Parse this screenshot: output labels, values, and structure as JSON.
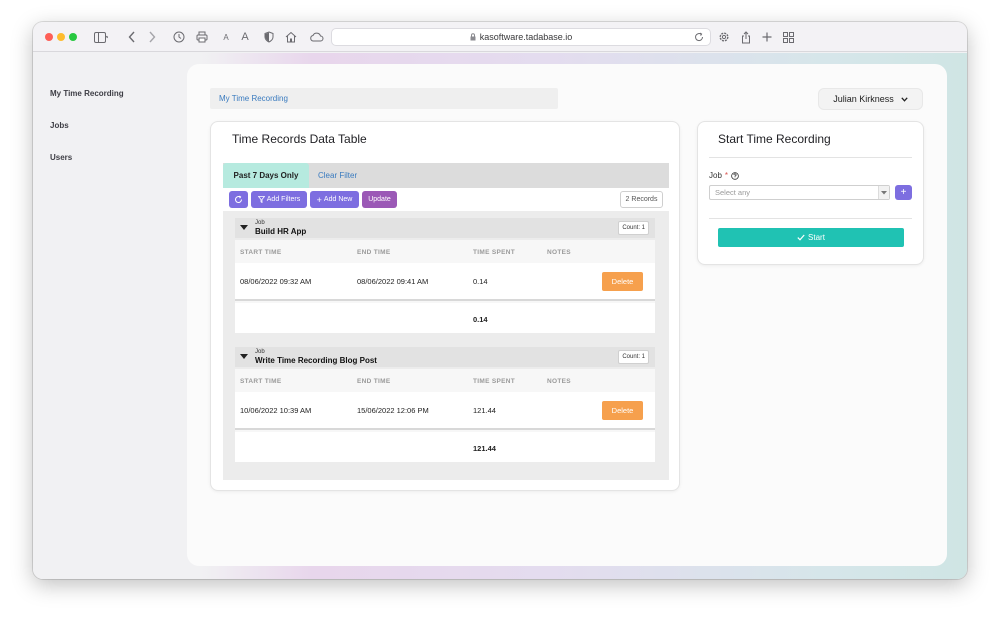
{
  "browser": {
    "url": "kasoftware.tadabase.io"
  },
  "sidebar": {
    "items": [
      {
        "label": "My Time Recording"
      },
      {
        "label": "Jobs"
      },
      {
        "label": "Users"
      }
    ]
  },
  "header": {
    "breadcrumb": "My Time Recording",
    "user_name": "Julian Kirkness"
  },
  "table_card": {
    "title": "Time Records Data Table",
    "tabs": {
      "active": "Past 7 Days Only",
      "link": "Clear Filter"
    },
    "toolbar": {
      "add_filters": "Add Filters",
      "add_new": "Add New",
      "update": "Update",
      "records": "2 Records"
    },
    "columns": [
      "START TIME",
      "END TIME",
      "TIME SPENT",
      "NOTES"
    ],
    "group_label": "Job",
    "groups": [
      {
        "name": "Build HR App",
        "count": "Count: 1",
        "row": {
          "start": "08/06/2022 09:32 AM",
          "end": "08/06/2022 09:41 AM",
          "spent": "0.14",
          "action": "Delete"
        },
        "total": "0.14"
      },
      {
        "name": "Write Time Recording Blog Post",
        "count": "Count: 1",
        "row": {
          "start": "10/06/2022 10:39 AM",
          "end": "15/06/2022 12:06 PM",
          "spent": "121.44",
          "action": "Delete"
        },
        "total": "121.44"
      }
    ]
  },
  "start_card": {
    "title": "Start Time Recording",
    "job_label": "Job",
    "required_mark": "*",
    "select_placeholder": "Select any",
    "plus": "+",
    "start_label": "Start"
  },
  "colors": {
    "accent_purple": "#7d6ee0",
    "update_purple": "#9b59b6",
    "delete_orange": "#f6a04d",
    "start_teal": "#20c2b3",
    "tab_active_bg": "#b6eadf",
    "link_blue": "#3a7bbf"
  },
  "icons": [
    "sidebar-icon",
    "back-icon",
    "forward-icon",
    "history-icon",
    "printer-icon",
    "shield-icon",
    "home-icon",
    "cloud-icon",
    "lock-icon",
    "reload-icon",
    "gear-icon",
    "share-icon",
    "new-tab-icon",
    "grid-icon",
    "refresh-icon",
    "filter-icon",
    "chevron-down-icon",
    "help-icon",
    "check-icon"
  ]
}
